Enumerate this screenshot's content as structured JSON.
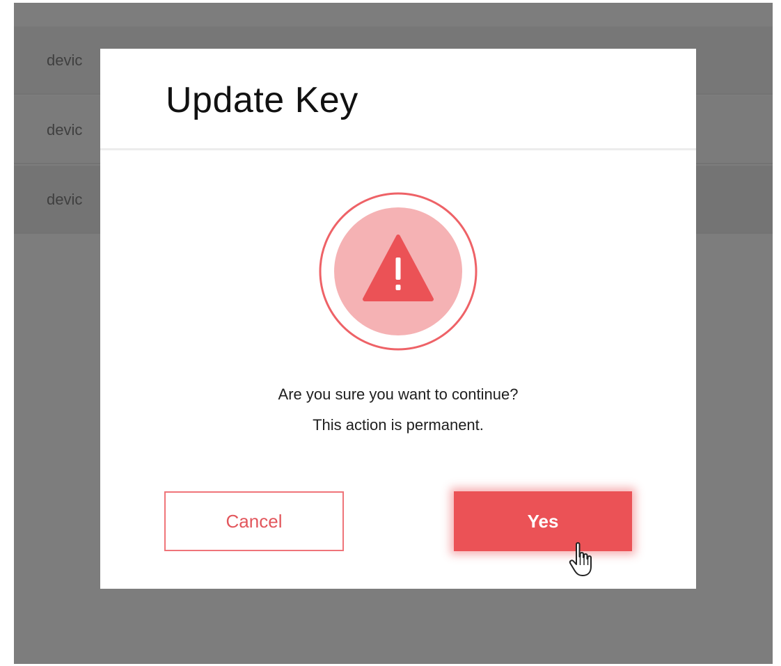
{
  "background": {
    "rows": [
      {
        "label": "devic"
      },
      {
        "label": "devic"
      },
      {
        "label": "devic"
      }
    ]
  },
  "dialog": {
    "title": "Update Key",
    "icon": "warning-triangle-icon",
    "message_line1": "Are you sure you want to continue?",
    "message_line2": "This action is permanent.",
    "cancel_label": "Cancel",
    "confirm_label": "Yes"
  },
  "colors": {
    "accent": "#eb5256",
    "icon_circle": "#f5b2b4",
    "overlay": "#7d7d7d"
  }
}
